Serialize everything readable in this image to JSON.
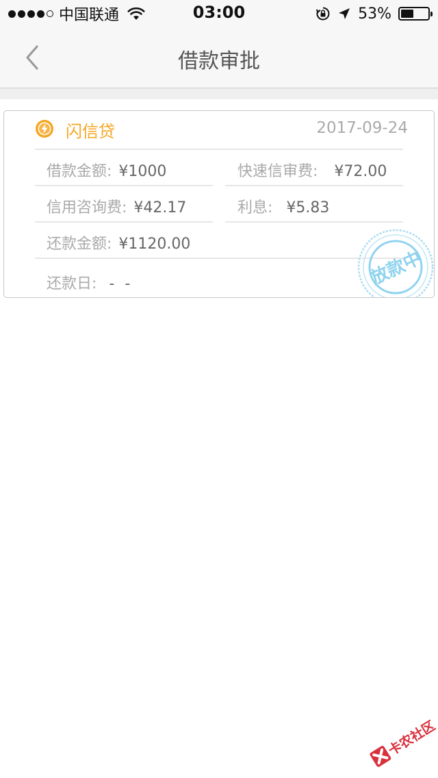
{
  "status_bar": {
    "carrier": "中国联通",
    "time": "03:00",
    "battery_percent": "53%",
    "battery_level": 0.53,
    "signal_bars_filled": 4,
    "signal_bars_total": 5
  },
  "nav": {
    "title": "借款审批",
    "back_icon": "chevron-left-icon"
  },
  "loan_card": {
    "lender": "闪信贷",
    "lender_icon": "lightning-bolt-icon",
    "date": "2017-09-24",
    "loan_amount_label": "借款金额:",
    "loan_amount_value": "¥1000",
    "fast_review_fee_label": "快速信审费:",
    "fast_review_fee_value": "¥72.00",
    "credit_consult_fee_label": "信用咨询费:",
    "credit_consult_fee_value": "¥42.17",
    "interest_label": "利息:",
    "interest_value": "¥5.83",
    "repay_amount_label": "还款金额:",
    "repay_amount_value": "¥1120.00",
    "repay_date_label": "还款日:",
    "repay_date_value": "- -",
    "stamp_text": "放款中"
  },
  "watermark_text": "卡农社区",
  "colors": {
    "accent_orange": "#f5a623",
    "stamp_blue": "#8fd3ef",
    "label_gray": "#a9a9a9",
    "value_gray": "#666666"
  }
}
